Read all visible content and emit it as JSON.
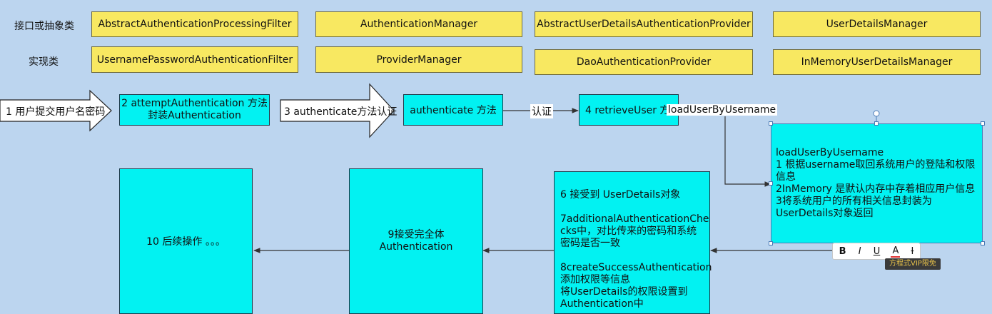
{
  "rows": {
    "interface_label": "接口或抽象类",
    "impl_label": "实现类"
  },
  "interfaces": [
    "AbstractAuthenticationProcessingFilter",
    "AuthenticationManager",
    "AbstractUserDetailsAuthenticationProvider",
    "UserDetailsManager"
  ],
  "implementations": [
    "UsernamePasswordAuthenticationFilter",
    "ProviderManager",
    "DaoAuthenticationProvider",
    "InMemoryUserDetailsManager"
  ],
  "flow": {
    "step1": "1 用户提交用户名密码",
    "step2": "2 attemptAuthentication 方法\n封装Authentication",
    "step3": "3 authenticate方法认证",
    "authenticate": "authenticate 方法",
    "auth_label": "认证",
    "step4": "4 retrieveUser 方法",
    "load_label": "loadUserByUsername"
  },
  "load_box": " loadUserByUsername\n1 根据username取回系统用户的登陆和权限\n信息\n2InMemory 是默认内存中存着相应用户信息\n3将系统用户的所有相关信息封装为\nUserDetails对象返回",
  "details_box": "6 接受到 UserDetails对象\n\n7additionalAuthenticationChe\ncks中，对比传来的密码和系统\n密码是否一致\n\n8createSuccessAuthentication\n添加权限等信息\n将UserDetails的权限设置到\nAuthentication中",
  "step9": "9接受完全体\nAuthentication",
  "step10": "10 后续操作 。。。",
  "toolbar": {
    "bold": "B",
    "italic": "I",
    "underline": "U",
    "font_color": "A",
    "clear_format": "Ɨ",
    "tooltip": "方程式VIP限免"
  }
}
